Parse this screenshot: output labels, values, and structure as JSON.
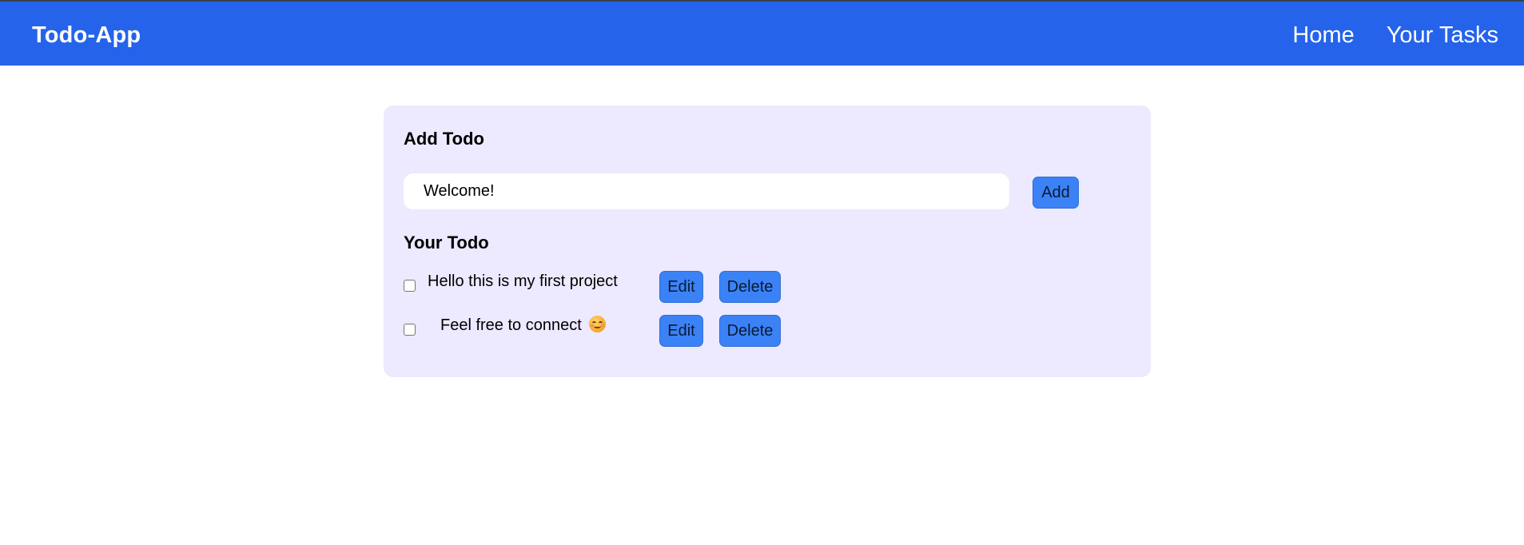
{
  "navbar": {
    "brand": "Todo-App",
    "links": [
      "Home",
      "Your Tasks"
    ],
    "color": "#2563eb"
  },
  "add_section": {
    "title": "Add Todo",
    "input_value": "Welcome!",
    "add_label": "Add"
  },
  "list_section": {
    "title": "Your Todo",
    "items": [
      {
        "text": "Hello this is my first project",
        "checked": false,
        "emoji": "",
        "edit_label": "Edit",
        "delete_label": "Delete"
      },
      {
        "text": "Feel free to connect",
        "checked": false,
        "emoji": "smiling-face-icon",
        "edit_label": "Edit",
        "delete_label": "Delete"
      }
    ]
  },
  "colors": {
    "card_bg": "#ede9fe",
    "button_bg": "#3b82f6"
  }
}
